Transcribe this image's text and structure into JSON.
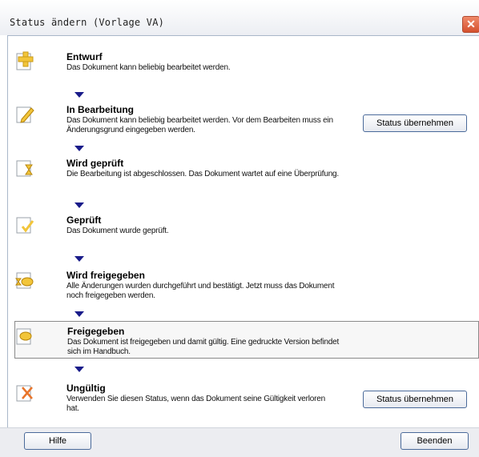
{
  "window": {
    "title": "Status ändern (Vorlage VA)",
    "close_symbol": "✕"
  },
  "statuses": [
    {
      "name": "Entwurf",
      "desc": "Das Dokument kann beliebig bearbeitet werden.",
      "icon": "draft-plus-icon"
    },
    {
      "name": "In Bearbeitung",
      "desc": "Das Dokument kann beliebig bearbeitet werden. Vor dem Bearbeiten muss ein Änderungsgrund eingegeben werden.",
      "icon": "edit-pencil-icon"
    },
    {
      "name": "Wird geprüft",
      "desc": "Die Bearbeitung ist abgeschlossen. Das Dokument wartet auf eine Überprüfung.",
      "icon": "hourglass-icon"
    },
    {
      "name": "Geprüft",
      "desc": "Das Dokument wurde geprüft.",
      "icon": "checkmark-icon"
    },
    {
      "name": "Wird freigegeben",
      "desc": "Alle Änderungen wurden durchgeführt und bestätigt. Jetzt muss das Dokument noch freigegeben werden.",
      "icon": "pending-release-icon"
    },
    {
      "name": "Freigegeben",
      "desc": "Das Dokument ist freigegeben und damit gültig. Eine gedruckte Version befindet sich im Handbuch.",
      "icon": "released-seal-icon"
    },
    {
      "name": "Ungültig",
      "desc": "Verwenden Sie diesen Status, wenn das Dokument seine Gültigkeit verloren hat.",
      "icon": "invalid-cross-icon"
    }
  ],
  "buttons": {
    "apply_status": "Status übernehmen",
    "help": "Hilfe",
    "finish": "Beenden"
  },
  "colors": {
    "arrow": "#1a1c8a",
    "icon_yellow": "#f2c53a",
    "invalid_orange": "#e8742a"
  }
}
